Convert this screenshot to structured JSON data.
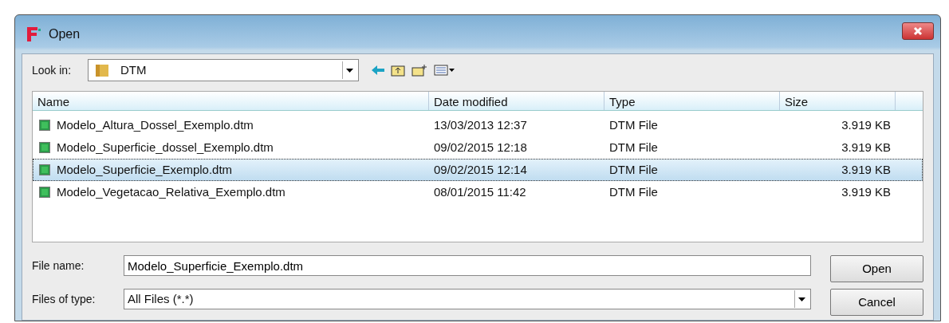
{
  "window": {
    "title": "Open"
  },
  "look_in": {
    "label": "Look in:",
    "value": "DTM"
  },
  "columns": [
    "Name",
    "Date modified",
    "Type",
    "Size"
  ],
  "rows": [
    {
      "name": "Modelo_Altura_Dossel_Exemplo.dtm",
      "date": "13/03/2013 12:37",
      "type": "DTM File",
      "size": "3.919 KB",
      "selected": false
    },
    {
      "name": "Modelo_Superficie_dossel_Exemplo.dtm",
      "date": "09/02/2015 12:18",
      "type": "DTM File",
      "size": "3.919 KB",
      "selected": false
    },
    {
      "name": "Modelo_Superficie_Exemplo.dtm",
      "date": "09/02/2015 12:14",
      "type": "DTM File",
      "size": "3.919 KB",
      "selected": true
    },
    {
      "name": "Modelo_Vegetacao_Relativa_Exemplo.dtm",
      "date": "08/01/2015 11:42",
      "type": "DTM File",
      "size": "3.919 KB",
      "selected": false
    }
  ],
  "file_name": {
    "label": "File name:",
    "value": "Modelo_Superficie_Exemplo.dtm"
  },
  "file_type": {
    "label": "Files of type:",
    "value": "All Files (*.*)"
  },
  "buttons": [
    "Open",
    "Cancel"
  ]
}
